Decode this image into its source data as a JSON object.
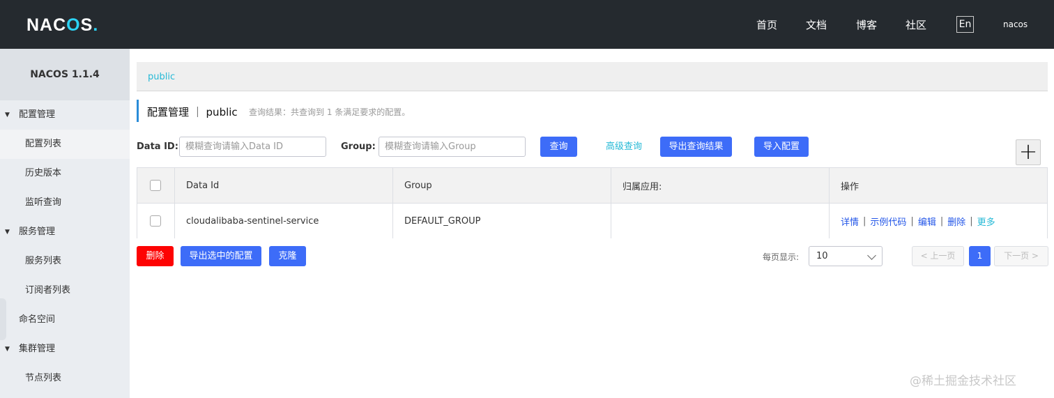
{
  "header": {
    "logo_main": "NAC",
    "logo_o": "O",
    "logo_tail": "S",
    "logo_dot": ".",
    "nav": [
      "首页",
      "文档",
      "博客",
      "社区"
    ],
    "lang": "En",
    "user": "nacos"
  },
  "sidebar": {
    "title": "NACOS 1.1.4",
    "groups": [
      {
        "label": "配置管理",
        "items": [
          "配置列表",
          "历史版本",
          "监听查询"
        ]
      },
      {
        "label": "服务管理",
        "items": [
          "服务列表",
          "订阅者列表"
        ]
      },
      {
        "label": "命名空间",
        "items": []
      },
      {
        "label": "集群管理",
        "items": [
          "节点列表"
        ]
      }
    ]
  },
  "namespace": {
    "current": "public"
  },
  "page": {
    "title": "配置管理 ｜ public",
    "query_result": "查询结果：共查询到 1 条满足要求的配置。"
  },
  "search": {
    "data_id_label": "Data ID:",
    "data_id_placeholder": "模糊查询请输入Data ID",
    "data_id_value": "",
    "group_label": "Group:",
    "group_placeholder": "模糊查询请输入Group",
    "group_value": "",
    "query_btn": "查询",
    "advanced_btn": "高级查询",
    "export_result_btn": "导出查询结果",
    "import_btn": "导入配置",
    "add_btn": "+"
  },
  "table": {
    "columns": [
      "Data Id",
      "Group",
      "归属应用:",
      "操作"
    ],
    "rows": [
      {
        "data_id": "cloudalibaba-sentinel-service",
        "group": "DEFAULT_GROUP",
        "app": ""
      }
    ],
    "ops": [
      "详情",
      "示例代码",
      "编辑",
      "删除",
      "更多"
    ]
  },
  "actions": {
    "delete_btn": "删除",
    "export_selected_btn": "导出选中的配置",
    "clone_btn": "克隆"
  },
  "pagination": {
    "page_size_label": "每页显示:",
    "page_size": "10",
    "prev": "< 上一页",
    "current": "1",
    "next": "下一页 >"
  },
  "watermark": "@稀土掘金技术社区",
  "colors": {
    "topbar": "#252a2f",
    "primary": "#3d6cf8",
    "danger": "#fd0303",
    "link": "#26b9d6"
  }
}
